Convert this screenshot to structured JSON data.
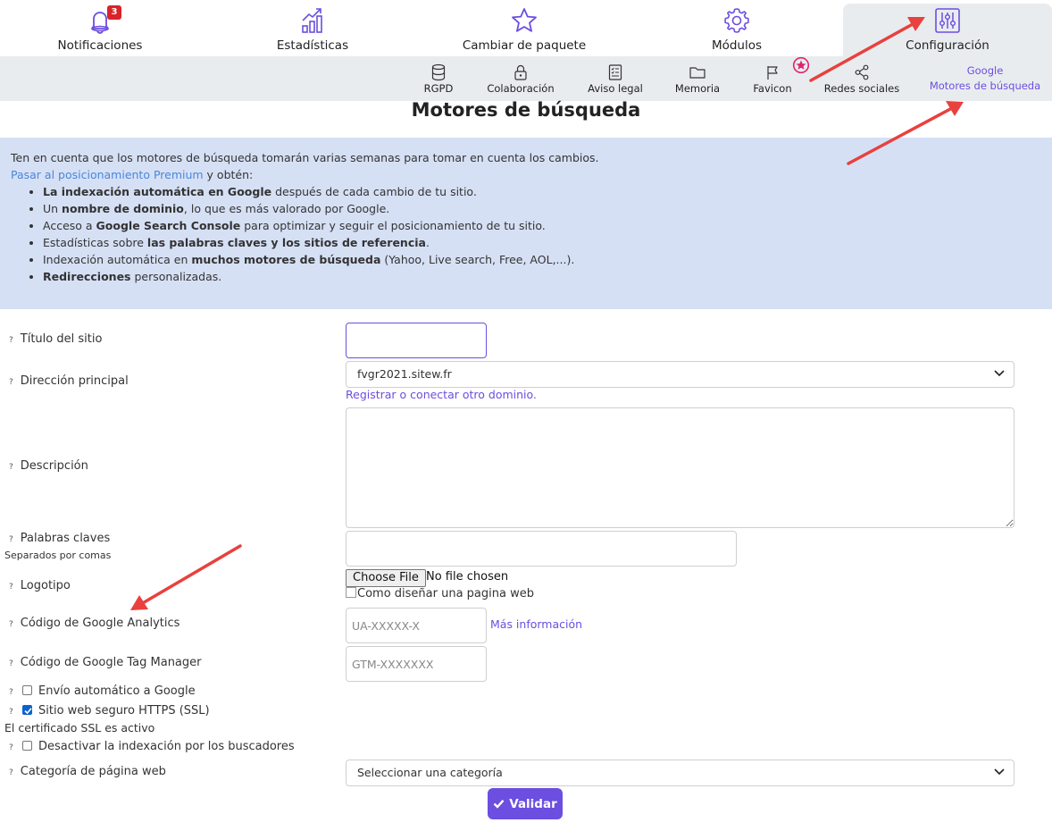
{
  "top_nav": {
    "notifications": {
      "label": "Notificaciones",
      "badge": "3",
      "icon": "bell-icon"
    },
    "statistics": {
      "label": "Estadísticas",
      "icon": "chart-icon"
    },
    "package": {
      "label": "Cambiar de paquete",
      "icon": "star-icon"
    },
    "modules": {
      "label": "Módulos",
      "icon": "gear-icon"
    },
    "configuration": {
      "label": "Configuración",
      "icon": "sliders-icon",
      "active": true
    }
  },
  "sub_nav": {
    "rgpd": {
      "label": "RGPD",
      "icon": "database-icon"
    },
    "collaboration": {
      "label": "Colaboración",
      "icon": "lock-icon"
    },
    "legal": {
      "label": "Aviso legal",
      "icon": "document-list-icon"
    },
    "memory": {
      "label": "Memoria",
      "icon": "folder-icon"
    },
    "favicon": {
      "label": "Favicon",
      "icon": "flag-icon"
    },
    "social": {
      "label": "Redes sociales",
      "icon": "share-icon"
    },
    "search_engines": {
      "top_label": "Google",
      "label": "Motores de búsqueda",
      "active": true
    }
  },
  "page": {
    "title": "Motores de búsqueda"
  },
  "info": {
    "intro": "Ten en cuenta que los motores de búsqueda tomarán varias semanas para tomar en cuenta los cambios.",
    "premium_link": "Pasar al posicionamiento Premium",
    "premium_suffix": " y obtén:",
    "bullets": [
      {
        "pre": "",
        "bold": "La indexación automática en Google",
        "post": " después de cada cambio de tu sitio."
      },
      {
        "pre": "Un ",
        "bold": "nombre de dominio",
        "post": ", lo que es más valorado por Google."
      },
      {
        "pre": "Acceso a ",
        "bold": "Google Search Console",
        "post": " para optimizar y seguir el posicionamiento de tu sitio."
      },
      {
        "pre": "Estadísticas sobre ",
        "bold": "las palabras claves y los sitios de referencia",
        "post": "."
      },
      {
        "pre": "Indexación automática en ",
        "bold": "muchos motores de búsqueda",
        "post": " (Yahoo, Live search, Free, AOL,...)."
      },
      {
        "pre": "",
        "bold": "Redirecciones",
        "post": " personalizadas."
      }
    ]
  },
  "form": {
    "help_mark": "?",
    "site_title": {
      "label": "Título del sitio",
      "value": ""
    },
    "main_address": {
      "label": "Dirección principal",
      "value": "fvgr2021.sitew.fr",
      "link": "Registrar o conectar otro dominio."
    },
    "description": {
      "label": "Descripción",
      "value": ""
    },
    "keywords": {
      "label": "Palabras claves",
      "hint": "Separados por comas",
      "value": ""
    },
    "logo": {
      "label": "Logotipo",
      "button": "Choose File",
      "status": "No file chosen",
      "image_alt": "Como diseñar una pagina web"
    },
    "analytics": {
      "label": "Código de Google Analytics",
      "placeholder": "UA-XXXXX-X",
      "link": "Más información"
    },
    "tag_manager": {
      "label": "Código de Google Tag Manager",
      "placeholder": "GTM-XXXXXXX"
    },
    "auto_send": {
      "label": "Envío automático a Google",
      "checked": false
    },
    "https": {
      "label": "Sitio web seguro HTTPS (SSL)",
      "checked": true,
      "note": "El certificado SSL es activo"
    },
    "deindex": {
      "label": "Desactivar la indexación por los buscadores",
      "checked": false
    },
    "category": {
      "label": "Categoría de página web",
      "value": "Seleccionar una categoría"
    },
    "submit": "Validar"
  },
  "colors": {
    "accent": "#6c4ee0",
    "info_bg": "#d6e0f5",
    "annotation_arrow": "#e8413e",
    "premium_star": "#e0246c"
  }
}
